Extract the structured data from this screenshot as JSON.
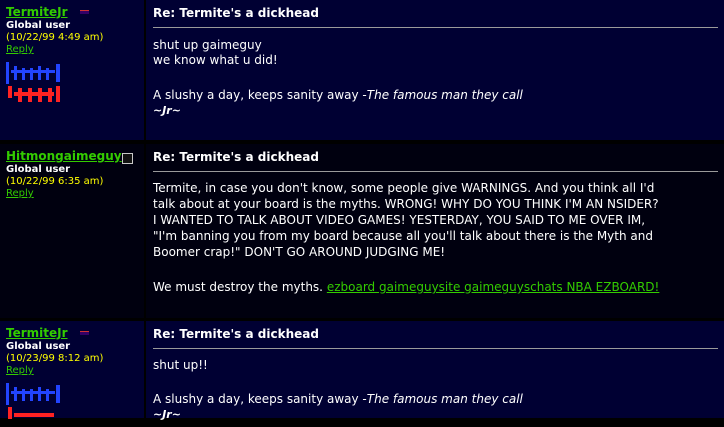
{
  "posts": [
    {
      "author": "TermiteJr",
      "role": "Global user",
      "date": "(10/22/99 4:49 am)",
      "reply": "Reply",
      "title": "Re: Termite's a dickhead",
      "lines": [
        "shut up gaimeguy",
        "we know what u did!"
      ],
      "sig_text": "A slushy a day, keeps sanity away -",
      "sig_quote": "The famous man they call",
      "sig_name": "~Jr~",
      "sig_image_colors": [
        "#2244ff",
        "#ff2222",
        "#ffffff"
      ]
    },
    {
      "author": "Hitmongaimeguy",
      "role": "Global user",
      "date": "(10/22/99 6:35 am)",
      "reply": "Reply",
      "title": "Re: Termite's a dickhead",
      "lines": [
        "Termite, in case you don't know, some people give WARNINGS. And you think all I'd",
        "talk about at your board is the myths. WRONG! WHY DO YOU THINK I'M AN NSIDER?",
        "I WANTED TO TALK ABOUT VIDEO GAMES! YESTERDAY, YOU SAID TO ME OVER IM,",
        "\"I'm banning you from my board because all you'll talk about there is the Myth and",
        "Boomer crap!\" DON'T GO AROUND JUDGING ME!"
      ],
      "sig_text": "We must destroy the myths.",
      "sig_link": "ezboard gaimeguysite gaimeguyschats NBA EZBOARD!"
    },
    {
      "author": "TermiteJr",
      "role": "Global user",
      "date": "(10/23/99 8:12 am)",
      "reply": "Reply",
      "title": "Re: Termite's a dickhead",
      "lines": [
        "shut up!!"
      ],
      "sig_text": "A slushy a day, keeps sanity away -",
      "sig_quote": "The famous man they call",
      "sig_name": "~Jr~",
      "sig_image_colors": [
        "#2244ff",
        "#ff2222",
        "#ffffff"
      ]
    }
  ]
}
